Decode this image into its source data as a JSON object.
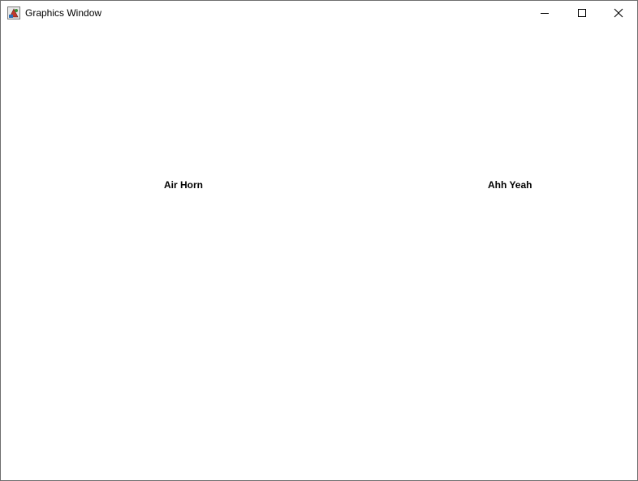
{
  "window": {
    "title": "Graphics Window",
    "app_icon": "java-app-icon",
    "controls": {
      "minimize_icon": "minimize-icon",
      "maximize_icon": "maximize-icon",
      "close_icon": "close-icon"
    }
  },
  "canvas": {
    "background": "#ffffff",
    "buttons": [
      {
        "label": "Air Horn"
      },
      {
        "label": "Ahh Yeah"
      }
    ]
  }
}
